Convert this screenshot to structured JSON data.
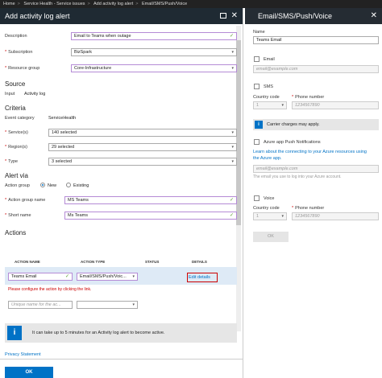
{
  "breadcrumb": [
    "Home",
    "Service Health - Service issues",
    "Add activity log alert",
    "Email/SMS/Push/Voice"
  ],
  "left_blade": {
    "title": "Add activity log alert",
    "description_label": "Description",
    "description_value": "Email to Teams when outage",
    "subscription_label": "Subscription",
    "subscription_value": "BizSpark",
    "resource_group_label": "Resource group",
    "resource_group_value": "Core-Infrastructure",
    "source_heading": "Source",
    "input_label": "Input",
    "input_value": "Activity log",
    "criteria_heading": "Criteria",
    "event_category_label": "Event category",
    "event_category_value": "ServiceHealth",
    "services_label": "Service(s)",
    "services_value": "140 selected",
    "regions_label": "Region(s)",
    "regions_value": "29 selected",
    "type_label": "Type",
    "type_value": "3 selected",
    "alert_via_heading": "Alert via",
    "action_group_label": "Action group",
    "action_group_new": "New",
    "action_group_existing": "Existing",
    "action_group_name_label": "Action group name",
    "action_group_name_value": "MS Teams",
    "short_name_label": "Short name",
    "short_name_value": "Ms Teams",
    "actions_heading": "Actions",
    "table_headers": [
      "ACTION NAME",
      "ACTION TYPE",
      "STATUS",
      "DETAILS"
    ],
    "row_action_name": "Teams Email",
    "row_action_type": "Email/SMS/Push/Voic...",
    "row_details_link": "Edit details",
    "row_error": "Please configure the action by clicking the link.",
    "new_action_placeholder": "Unique name for the ac...",
    "info_text": "It can take up to 5 minutes for an Activity log alert to become active.",
    "privacy_link": "Privacy Statement",
    "ok_button": "OK"
  },
  "right_blade": {
    "title": "Email/SMS/Push/Voice",
    "name_label": "Name",
    "name_value": "Teams Email",
    "email_label": "Email",
    "email_placeholder": "email@example.com",
    "sms_label": "SMS",
    "country_code_label": "Country code",
    "phone_number_label": "Phone number",
    "country_code_value": "1",
    "phone_placeholder": "1234567890",
    "carrier_info": "Carrier charges may apply.",
    "push_label": "Azure app Push Notifications",
    "push_link": "Learn about the connecting to your Azure resources using the Azure app.",
    "push_email_placeholder": "email@example.com",
    "push_hint": "The email you use to log into your Azure account.",
    "voice_label": "Voice",
    "voice_country_code_label": "Country code",
    "voice_phone_label": "Phone number",
    "voice_country_value": "1",
    "voice_phone_placeholder": "1234567890",
    "ok_button": "OK"
  }
}
